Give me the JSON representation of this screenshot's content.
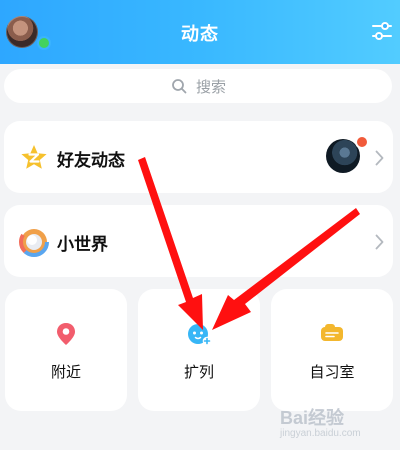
{
  "header": {
    "title": "动态"
  },
  "search": {
    "placeholder": "搜索"
  },
  "rows": [
    {
      "label": "好友动态",
      "has_notification": true
    },
    {
      "label": "小世界"
    }
  ],
  "tiles": [
    {
      "label": "附近",
      "icon": "location-pin-icon",
      "color": "#f25d6d"
    },
    {
      "label": "扩列",
      "icon": "friend-add-icon",
      "color": "#37b6f6"
    },
    {
      "label": "自习室",
      "icon": "study-room-icon",
      "color": "#f3b72e"
    }
  ],
  "colors": {
    "header_start": "#2ea7ff",
    "header_end": "#52ccff",
    "arrow": "#ff1010"
  },
  "watermark": {
    "text": "Bai经验",
    "sub": "jingyan.baidu.com"
  }
}
